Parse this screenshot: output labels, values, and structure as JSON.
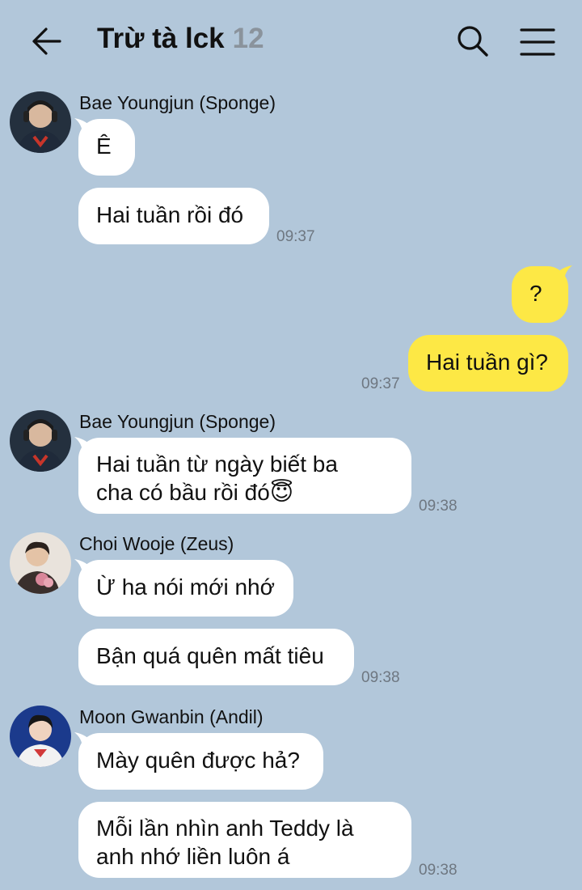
{
  "header": {
    "title": "Trừ tà lck",
    "member_count": "12",
    "back_icon": "arrow-left-icon",
    "search_icon": "search-icon",
    "menu_icon": "hamburger-menu-icon"
  },
  "colors": {
    "background": "#b2c7da",
    "incoming_bubble": "#ffffff",
    "outgoing_bubble": "#fde845",
    "timestamp": "#6e7781"
  },
  "messages": [
    {
      "sender": "Bae Youngjun (Sponge)",
      "direction": "incoming",
      "text": "Ê"
    },
    {
      "direction": "incoming",
      "text": "Hai tuần rồi đó",
      "time": "09:37"
    },
    {
      "direction": "outgoing",
      "text": "?"
    },
    {
      "direction": "outgoing",
      "text": "Hai tuần gì?",
      "time": "09:37"
    },
    {
      "sender": "Bae Youngjun (Sponge)",
      "direction": "incoming",
      "line1": "Hai tuần từ ngày biết ba",
      "line2": "cha có bầu rồi đó😇",
      "time": "09:38"
    },
    {
      "sender": "Choi Wooje (Zeus)",
      "direction": "incoming",
      "text": "Ừ ha nói mới nhớ"
    },
    {
      "direction": "incoming",
      "text": "Bận quá quên mất tiêu",
      "time": "09:38"
    },
    {
      "sender": "Moon Gwanbin (Andil)",
      "direction": "incoming",
      "text": "Mày quên được hả?"
    },
    {
      "direction": "incoming",
      "line1": "Mỗi lần nhìn anh Teddy là",
      "line2": "anh nhớ liền luôn á",
      "time": "09:38"
    }
  ]
}
